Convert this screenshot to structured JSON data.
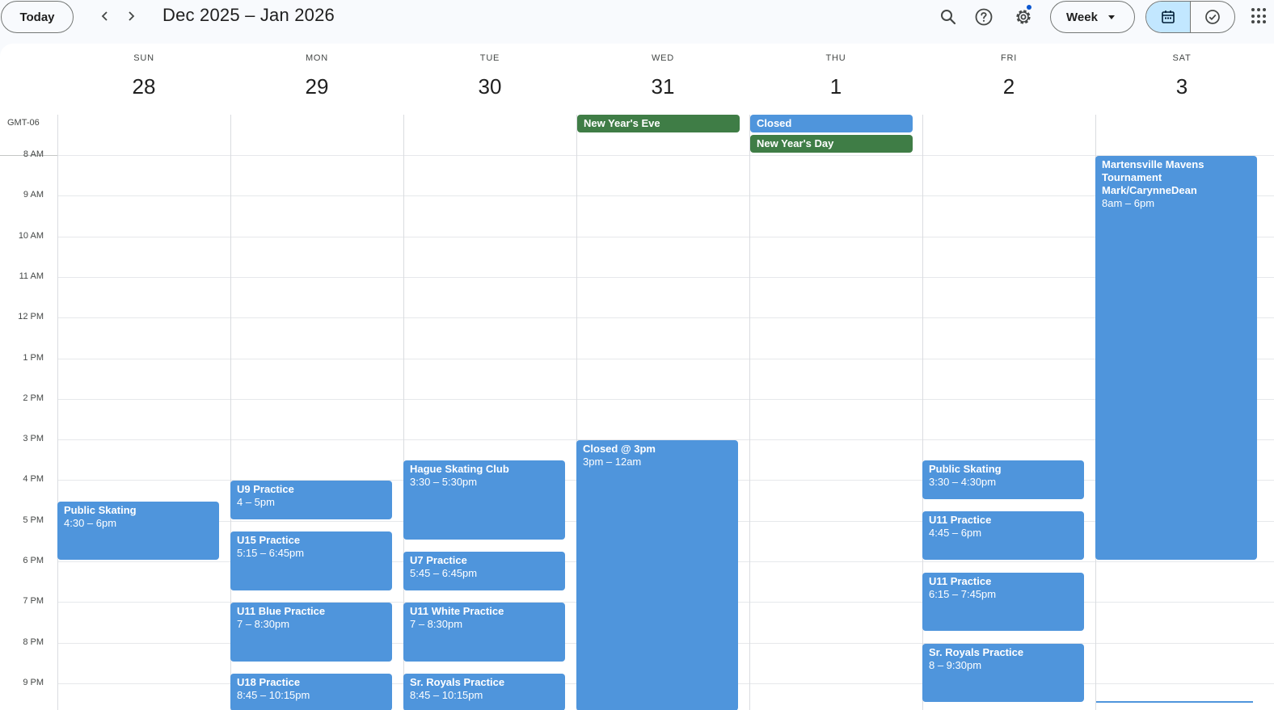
{
  "header": {
    "today_label": "Today",
    "range_title": "Dec 2025 – Jan 2026",
    "view_label": "Week"
  },
  "timezone": "GMT-06",
  "days": [
    {
      "dow": "SUN",
      "num": "28"
    },
    {
      "dow": "MON",
      "num": "29"
    },
    {
      "dow": "TUE",
      "num": "30"
    },
    {
      "dow": "WED",
      "num": "31"
    },
    {
      "dow": "THU",
      "num": "1"
    },
    {
      "dow": "FRI",
      "num": "2"
    },
    {
      "dow": "SAT",
      "num": "3"
    }
  ],
  "hours": [
    "8 AM",
    "9 AM",
    "10 AM",
    "11 AM",
    "12 PM",
    "1 PM",
    "2 PM",
    "3 PM",
    "4 PM",
    "5 PM",
    "6 PM",
    "7 PM",
    "8 PM",
    "9 PM"
  ],
  "allday": [
    {
      "day": 3,
      "row": 0,
      "title": "New Year's Eve",
      "color": "#3f7d46"
    },
    {
      "day": 4,
      "row": 0,
      "title": "Closed",
      "color": "#4f95dc"
    },
    {
      "day": 4,
      "row": 1,
      "title": "New Year's Day",
      "color": "#3f7d46"
    }
  ],
  "events": [
    {
      "day": 0,
      "start": 16.5,
      "end": 18,
      "title": "Public Skating",
      "time": "4:30 – 6pm"
    },
    {
      "day": 1,
      "start": 16,
      "end": 17,
      "title": "U9 Practice",
      "time": "4 – 5pm"
    },
    {
      "day": 1,
      "start": 17.25,
      "end": 18.75,
      "title": "U15 Practice",
      "time": "5:15 – 6:45pm"
    },
    {
      "day": 1,
      "start": 19,
      "end": 20.5,
      "title": "U11 Blue Practice",
      "time": "7 – 8:30pm"
    },
    {
      "day": 1,
      "start": 20.75,
      "end": 22.25,
      "title": "U18 Practice",
      "time": "8:45 – 10:15pm"
    },
    {
      "day": 2,
      "start": 15.5,
      "end": 17.5,
      "title": "Hague Skating Club",
      "time": "3:30 – 5:30pm"
    },
    {
      "day": 2,
      "start": 17.75,
      "end": 18.75,
      "title": "U7 Practice",
      "time": "5:45 – 6:45pm"
    },
    {
      "day": 2,
      "start": 19,
      "end": 20.5,
      "title": "U11 White Practice",
      "time": "7 – 8:30pm"
    },
    {
      "day": 2,
      "start": 20.75,
      "end": 22.25,
      "title": "Sr. Royals Practice",
      "time": "8:45 – 10:15pm"
    },
    {
      "day": 3,
      "start": 15,
      "end": 24,
      "title": "Closed @ 3pm",
      "time": "3pm – 12am"
    },
    {
      "day": 5,
      "start": 15.5,
      "end": 16.5,
      "title": "Public Skating",
      "time": "3:30 – 4:30pm"
    },
    {
      "day": 5,
      "start": 16.75,
      "end": 18,
      "title": "U11 Practice",
      "time": "4:45 – 6pm"
    },
    {
      "day": 5,
      "start": 18.25,
      "end": 19.75,
      "title": "U11 Practice",
      "time": "6:15 – 7:45pm"
    },
    {
      "day": 5,
      "start": 20,
      "end": 21.5,
      "title": "Sr. Royals Practice",
      "time": "8 – 9:30pm"
    },
    {
      "day": 6,
      "start": 8,
      "end": 18,
      "title": "Martensville Mavens Tournament Mark/CarynneDean",
      "time": "8am – 6pm",
      "wrap": true
    }
  ]
}
